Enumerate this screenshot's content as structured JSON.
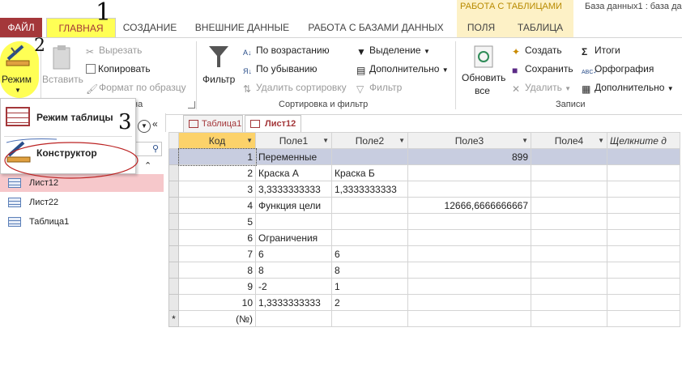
{
  "ribbon_tabs": {
    "file": "ФАЙЛ",
    "home": "ГЛАВНАЯ",
    "create": "СОЗДАНИЕ",
    "external": "ВНЕШНИЕ ДАННЫЕ",
    "dbtools": "РАБОТА С БАЗАМИ ДАННЫХ",
    "fields": "ПОЛЯ",
    "table": "ТАБЛИЦА",
    "context_title": "РАБОТА С ТАБЛИЦАМИ",
    "window_title": "База данных1 : база да"
  },
  "ribbon": {
    "views": {
      "mode": "Режим"
    },
    "clipboard": {
      "paste": "Вставить",
      "cut": "Вырезать",
      "copy": "Копировать",
      "format_painter": "Формат по образцу",
      "group_suffix": "на"
    },
    "sort_filter": {
      "filter": "Фильтр",
      "ascending": "По возрастанию",
      "descending": "По убыванию",
      "remove_sort": "Удалить сортировку",
      "selection": "Выделение",
      "advanced": "Дополнительно",
      "toggle_filter": "Фильтр",
      "group_label": "Сортировка и фильтр"
    },
    "records": {
      "refresh_all_1": "Обновить",
      "refresh_all_2": "все",
      "new": "Создать",
      "save": "Сохранить",
      "delete": "Удалить",
      "totals": "Итоги",
      "spelling": "Орфография",
      "more": "Дополнительно",
      "group_label": "Записи"
    }
  },
  "mode_menu": {
    "datasheet": "Режим таблицы",
    "design": "Конструктор"
  },
  "nav": {
    "items": [
      "Лист12",
      "Лист22",
      "Таблица1"
    ],
    "selected": "Лист12"
  },
  "doc_tabs": [
    "Таблица1",
    "Лист12"
  ],
  "grid": {
    "columns": [
      "Код",
      "Поле1",
      "Поле2",
      "Поле3",
      "Поле4",
      "Щелкните д"
    ],
    "rows": [
      {
        "kod": "1",
        "f1": "Переменные",
        "f2": "",
        "f3": "899",
        "f4": ""
      },
      {
        "kod": "2",
        "f1": "Краска А",
        "f2": "Краска Б",
        "f3": "",
        "f4": ""
      },
      {
        "kod": "3",
        "f1": "3,3333333333",
        "f2": "1,3333333333",
        "f3": "",
        "f4": ""
      },
      {
        "kod": "4",
        "f1": "Функция цели",
        "f2": "",
        "f3": "12666,6666666667",
        "f4": ""
      },
      {
        "kod": "5",
        "f1": "",
        "f2": "",
        "f3": "",
        "f4": ""
      },
      {
        "kod": "6",
        "f1": "Ограничения",
        "f2": "",
        "f3": "",
        "f4": ""
      },
      {
        "kod": "7",
        "f1": "6",
        "f2": "6",
        "f3": "",
        "f4": ""
      },
      {
        "kod": "8",
        "f1": "8",
        "f2": "8",
        "f3": "",
        "f4": ""
      },
      {
        "kod": "9",
        "f1": "-2",
        "f2": "1",
        "f3": "",
        "f4": ""
      },
      {
        "kod": "10",
        "f1": "1,3333333333",
        "f2": "2",
        "f3": "",
        "f4": ""
      }
    ],
    "new_row": {
      "marker": "*",
      "kod": "(№)"
    }
  },
  "annotations": {
    "one": "1",
    "two": "2",
    "three": "3"
  },
  "colors": {
    "access_red": "#a4373a",
    "highlight_yellow": "#ffff55",
    "nav_selected": "#f6c8cb"
  }
}
